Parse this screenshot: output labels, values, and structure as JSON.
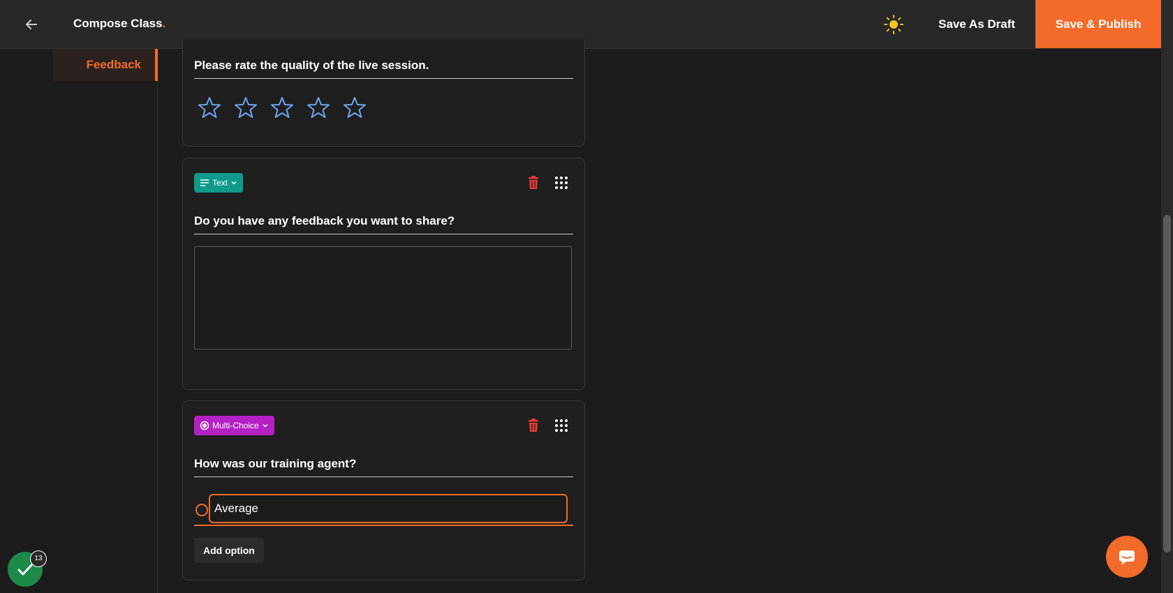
{
  "header": {
    "title": "Compose Class",
    "title_accent": ".",
    "save_draft_label": "Save As Draft",
    "publish_label": "Save & Publish"
  },
  "sidebar": {
    "active_section": "Feedback"
  },
  "questions": [
    {
      "type": "rating",
      "title": "Please rate the quality of the live session.",
      "stars": 5
    },
    {
      "type_label": "Text",
      "title": "Do you have any feedback you want to share?",
      "answer_value": ""
    },
    {
      "type_label": "Multi-Choice",
      "title": "How was our training agent?",
      "options": [
        "Average"
      ],
      "add_option_label": "Add option"
    }
  ],
  "status": {
    "count": "13"
  },
  "colors": {
    "accent": "#f26b2a",
    "text_badge": "#0f9a8a",
    "multichoice_badge": "#b521c4",
    "star": "#6fa5f0",
    "delete": "#e53935",
    "success": "#1e8a4a"
  }
}
